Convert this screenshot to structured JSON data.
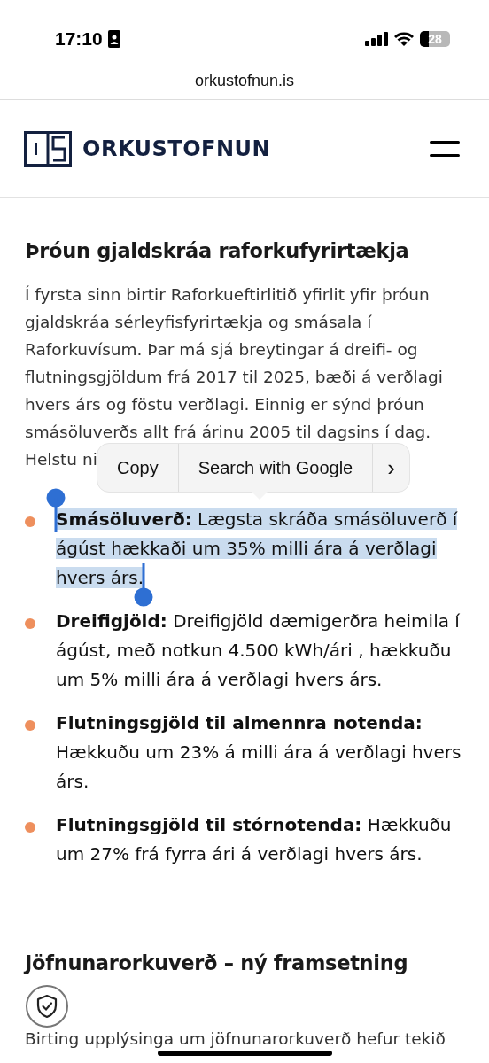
{
  "status_bar": {
    "time": "17:10",
    "battery": "28"
  },
  "address_bar": {
    "url": "orkustofnun.is"
  },
  "header": {
    "logo_text": "ORKUSTOFNUN"
  },
  "article": {
    "heading": "Þróun gjaldskráa raforkufyrirtækja",
    "paragraph": "Í fyrsta sinn birtir Raforkueftirlitið yfirlit yfir þróun gjaldskráa sérleyfisfyrirtækja og smásala í Raforkuvísum. Þar má sjá breytingar á dreifi- og flutningsgjöldum frá 2017 til 2025, bæði á verðlagi hvers árs og föstu verðlagi. Einnig er sýnd þróun smásöluverðs allt frá árinu 2005 til dagsins í dag.",
    "paragraph_tail": "Helstu ni",
    "bullets": [
      {
        "text": "**Smásöluverð:** Lægsta skráða smásöluverð í ágúst hækkaði um 35% milli ára á verðlagi hvers árs.",
        "selected": true
      },
      {
        "text": "**Dreifigjöld:** Dreifigjöld dæmigerðra heimila í ágúst, með notkun 4.500 kWh/ári , hækkuðu um 5% milli ára á verðlagi hvers árs.",
        "selected": false
      },
      {
        "text": "**Flutningsgjöld til almennra notenda:** Hækkuðu um 23% á milli ára á verðlagi hvers árs.",
        "selected": false
      },
      {
        "text": "**Flutningsgjöld til stórnotenda:** Hækkuðu um 27% frá fyrra ári á verðlagi hvers árs.",
        "selected": false
      }
    ],
    "heading_2": "Jöfnunarorkuverð – ný framsetning",
    "paragraph_2": "Birting upplýsinga um jöfnunarorkuverð hefur tekið"
  },
  "context_menu": {
    "items": [
      {
        "label": "Copy",
        "kind": "text"
      },
      {
        "label": "Search with Google",
        "kind": "text"
      },
      {
        "label": "›",
        "kind": "chevron"
      }
    ]
  }
}
